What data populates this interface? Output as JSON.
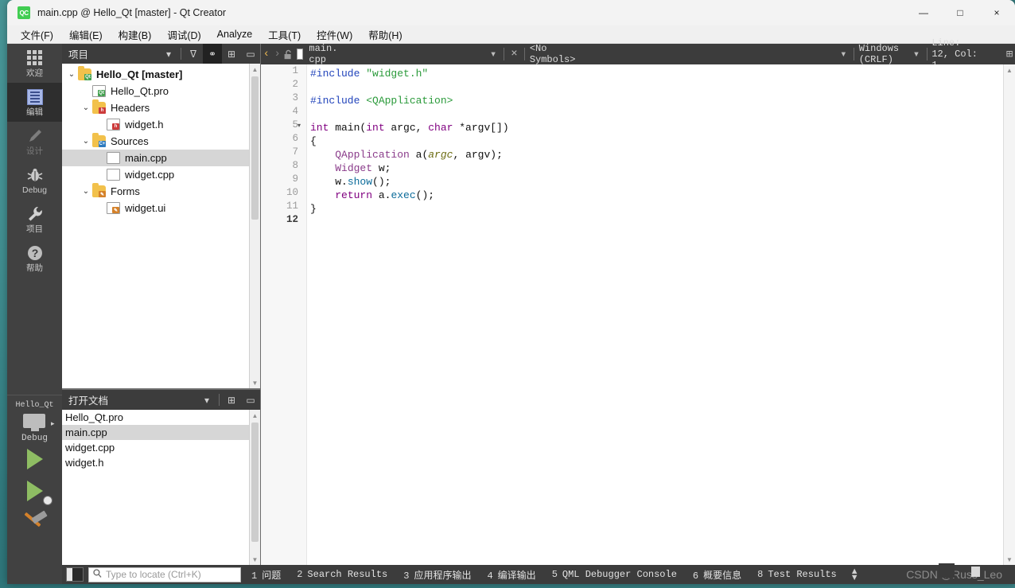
{
  "window": {
    "title": "main.cpp @ Hello_Qt [master] - Qt Creator",
    "logo": "QC",
    "minimize": "—",
    "maximize": "□",
    "close": "×"
  },
  "menubar": {
    "items": [
      {
        "label": "文件(F)"
      },
      {
        "label": "编辑(E)"
      },
      {
        "label": "构建(B)"
      },
      {
        "label": "调试(D)"
      },
      {
        "label": "Analyze"
      },
      {
        "label": "工具(T)"
      },
      {
        "label": "控件(W)"
      },
      {
        "label": "帮助(H)"
      }
    ]
  },
  "modebar": {
    "modes": [
      {
        "label": "欢迎",
        "icon": "grid-icon",
        "state": "normal"
      },
      {
        "label": "编辑",
        "icon": "edit-icon",
        "state": "active"
      },
      {
        "label": "设计",
        "icon": "pencil-icon",
        "state": "disabled"
      },
      {
        "label": "Debug",
        "icon": "bug-icon",
        "state": "normal"
      },
      {
        "label": "项目",
        "icon": "wrench-icon",
        "state": "normal"
      },
      {
        "label": "帮助",
        "icon": "question-icon",
        "state": "normal"
      }
    ],
    "kit": {
      "project": "Hello_Qt",
      "config": "Debug",
      "arrow": "▸"
    },
    "actions": [
      {
        "name": "run-button",
        "icon": "play-icon"
      },
      {
        "name": "debug-button",
        "icon": "play-bug-icon"
      },
      {
        "name": "build-button",
        "icon": "hammer-icon"
      }
    ]
  },
  "projects_dock": {
    "title": "项目",
    "tools": [
      {
        "name": "dock-selector-dropdown",
        "glyph": "▾"
      },
      {
        "name": "filter-icon",
        "glyph": "ᐁ"
      },
      {
        "name": "link-with-editor-icon",
        "glyph": "⚭",
        "active": true
      },
      {
        "name": "split-icon",
        "glyph": "⊞"
      },
      {
        "name": "close-dock-icon",
        "glyph": "▭"
      }
    ],
    "tree": [
      {
        "indent": 0,
        "twist": "⌄",
        "icon": "folder-qt",
        "tag": "Qt",
        "tagcolor": "#41a04e",
        "label": "Hello_Qt [master]",
        "bold": true,
        "selected": false
      },
      {
        "indent": 1,
        "twist": "",
        "icon": "file-qt",
        "tag": "Qt",
        "tagcolor": "#41a04e",
        "label": "Hello_Qt.pro",
        "bold": false,
        "selected": false
      },
      {
        "indent": 1,
        "twist": "⌄",
        "icon": "folder-h",
        "tag": "h",
        "tagcolor": "#cc3b3b",
        "label": "Headers",
        "bold": false,
        "selected": false
      },
      {
        "indent": 2,
        "twist": "",
        "icon": "file-h",
        "tag": "h",
        "tagcolor": "#cc3b3b",
        "label": "widget.h",
        "bold": false,
        "selected": false
      },
      {
        "indent": 1,
        "twist": "⌄",
        "icon": "folder-cpp",
        "tag": "C+",
        "tagcolor": "#2e7bbf",
        "label": "Sources",
        "bold": false,
        "selected": false
      },
      {
        "indent": 2,
        "twist": "",
        "icon": "file-plain",
        "tag": "",
        "tagcolor": "",
        "label": "main.cpp",
        "bold": false,
        "selected": true
      },
      {
        "indent": 2,
        "twist": "",
        "icon": "file-plain",
        "tag": "",
        "tagcolor": "",
        "label": "widget.cpp",
        "bold": false,
        "selected": false
      },
      {
        "indent": 1,
        "twist": "⌄",
        "icon": "folder-ui",
        "tag": "✎",
        "tagcolor": "#d4812a",
        "label": "Forms",
        "bold": false,
        "selected": false
      },
      {
        "indent": 2,
        "twist": "",
        "icon": "file-ui",
        "tag": "✎",
        "tagcolor": "#d4812a",
        "label": "widget.ui",
        "bold": false,
        "selected": false
      }
    ]
  },
  "opendocs_dock": {
    "title": "打开文档",
    "tools": [
      {
        "name": "dock-selector-dropdown",
        "glyph": "▾"
      },
      {
        "name": "split-icon",
        "glyph": "⊞"
      },
      {
        "name": "close-dock-icon",
        "glyph": "▭"
      }
    ],
    "documents": [
      {
        "label": "Hello_Qt.pro",
        "selected": false
      },
      {
        "label": "main.cpp",
        "selected": true
      },
      {
        "label": "widget.cpp",
        "selected": false
      },
      {
        "label": "widget.h",
        "selected": false
      }
    ]
  },
  "editor_toolbar": {
    "back": "‹",
    "forward": "›",
    "lock": "🔓",
    "filename": "main. cpp",
    "file_dropdown": "▾",
    "close": "×",
    "symbols": "<No Symbols>",
    "symbols_dropdown": "▾",
    "line_ending": "Windows (CRLF)",
    "line_ending_dropdown": "▾",
    "cursor_position": "Line: 12, Col: 1",
    "split": "⊞"
  },
  "editor": {
    "lines": [
      {
        "n": "1",
        "fold": "",
        "current": false,
        "tokens": [
          {
            "t": "#include ",
            "c": "pp"
          },
          {
            "t": "\"widget.h\"",
            "c": "str"
          }
        ]
      },
      {
        "n": "2",
        "fold": "",
        "current": false,
        "tokens": []
      },
      {
        "n": "3",
        "fold": "",
        "current": false,
        "tokens": [
          {
            "t": "#include ",
            "c": "pp"
          },
          {
            "t": "<QApplication>",
            "c": "str"
          }
        ]
      },
      {
        "n": "4",
        "fold": "",
        "current": false,
        "tokens": []
      },
      {
        "n": "5",
        "fold": "▾",
        "current": false,
        "tokens": [
          {
            "t": "int",
            "c": "k"
          },
          {
            "t": " main(",
            "c": ""
          },
          {
            "t": "int",
            "c": "k"
          },
          {
            "t": " argc, ",
            "c": ""
          },
          {
            "t": "char",
            "c": "k"
          },
          {
            "t": " *argv[])",
            "c": ""
          }
        ]
      },
      {
        "n": "6",
        "fold": "",
        "current": false,
        "tokens": [
          {
            "t": "{",
            "c": ""
          }
        ]
      },
      {
        "n": "7",
        "fold": "",
        "current": false,
        "tokens": [
          {
            "t": "    ",
            "c": ""
          },
          {
            "t": "QApplication",
            "c": "cls"
          },
          {
            "t": " a(",
            "c": ""
          },
          {
            "t": "argc",
            "c": "par"
          },
          {
            "t": ", argv);",
            "c": ""
          }
        ]
      },
      {
        "n": "8",
        "fold": "",
        "current": false,
        "tokens": [
          {
            "t": "    ",
            "c": ""
          },
          {
            "t": "Widget",
            "c": "cls"
          },
          {
            "t": " w;",
            "c": ""
          }
        ]
      },
      {
        "n": "9",
        "fold": "",
        "current": false,
        "tokens": [
          {
            "t": "    w.",
            "c": ""
          },
          {
            "t": "show",
            "c": "fn"
          },
          {
            "t": "();",
            "c": ""
          }
        ]
      },
      {
        "n": "10",
        "fold": "",
        "current": false,
        "tokens": [
          {
            "t": "    ",
            "c": ""
          },
          {
            "t": "return",
            "c": "k"
          },
          {
            "t": " a.",
            "c": ""
          },
          {
            "t": "exec",
            "c": "fn"
          },
          {
            "t": "();",
            "c": ""
          }
        ]
      },
      {
        "n": "11",
        "fold": "",
        "current": false,
        "tokens": [
          {
            "t": "}",
            "c": ""
          }
        ]
      },
      {
        "n": "12",
        "fold": "",
        "current": true,
        "tokens": []
      }
    ]
  },
  "statusbar": {
    "sidebar_toggle": "sidebar-toggle-icon",
    "locator_placeholder": "Type to locate (Ctrl+K)",
    "locator_value": "",
    "search_icon": "🔍",
    "panes": [
      {
        "n": "1",
        "label": "问题"
      },
      {
        "n": "2",
        "label": "Search Results"
      },
      {
        "n": "3",
        "label": "应用程序输出"
      },
      {
        "n": "4",
        "label": "编译输出"
      },
      {
        "n": "5",
        "label": "QML Debugger Console"
      },
      {
        "n": "6",
        "label": "概要信息"
      },
      {
        "n": "8",
        "label": "Test Results"
      }
    ],
    "updown": "⬍",
    "watermark": "CSDN @Russ_Leo"
  },
  "colors": {
    "accent_green": "#41cd52",
    "mode_active_bg": "#2e2e2e",
    "dock_header_bg": "#3c3c3c",
    "selection_bg": "#d6d6d6"
  }
}
